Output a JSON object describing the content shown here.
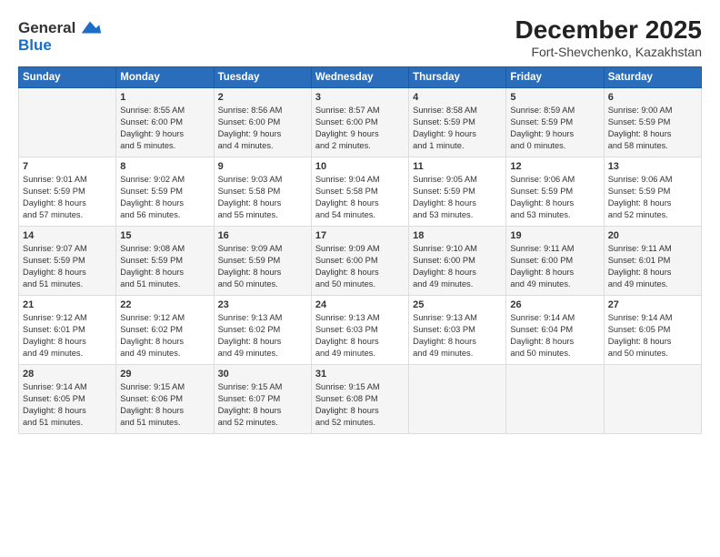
{
  "logo": {
    "general": "General",
    "blue": "Blue"
  },
  "title": "December 2025",
  "subtitle": "Fort-Shevchenko, Kazakhstan",
  "days_header": [
    "Sunday",
    "Monday",
    "Tuesday",
    "Wednesday",
    "Thursday",
    "Friday",
    "Saturday"
  ],
  "weeks": [
    [
      {
        "day": "",
        "text": ""
      },
      {
        "day": "1",
        "text": "Sunrise: 8:55 AM\nSunset: 6:00 PM\nDaylight: 9 hours\nand 5 minutes."
      },
      {
        "day": "2",
        "text": "Sunrise: 8:56 AM\nSunset: 6:00 PM\nDaylight: 9 hours\nand 4 minutes."
      },
      {
        "day": "3",
        "text": "Sunrise: 8:57 AM\nSunset: 6:00 PM\nDaylight: 9 hours\nand 2 minutes."
      },
      {
        "day": "4",
        "text": "Sunrise: 8:58 AM\nSunset: 5:59 PM\nDaylight: 9 hours\nand 1 minute."
      },
      {
        "day": "5",
        "text": "Sunrise: 8:59 AM\nSunset: 5:59 PM\nDaylight: 9 hours\nand 0 minutes."
      },
      {
        "day": "6",
        "text": "Sunrise: 9:00 AM\nSunset: 5:59 PM\nDaylight: 8 hours\nand 58 minutes."
      }
    ],
    [
      {
        "day": "7",
        "text": "Sunrise: 9:01 AM\nSunset: 5:59 PM\nDaylight: 8 hours\nand 57 minutes."
      },
      {
        "day": "8",
        "text": "Sunrise: 9:02 AM\nSunset: 5:59 PM\nDaylight: 8 hours\nand 56 minutes."
      },
      {
        "day": "9",
        "text": "Sunrise: 9:03 AM\nSunset: 5:58 PM\nDaylight: 8 hours\nand 55 minutes."
      },
      {
        "day": "10",
        "text": "Sunrise: 9:04 AM\nSunset: 5:58 PM\nDaylight: 8 hours\nand 54 minutes."
      },
      {
        "day": "11",
        "text": "Sunrise: 9:05 AM\nSunset: 5:59 PM\nDaylight: 8 hours\nand 53 minutes."
      },
      {
        "day": "12",
        "text": "Sunrise: 9:06 AM\nSunset: 5:59 PM\nDaylight: 8 hours\nand 53 minutes."
      },
      {
        "day": "13",
        "text": "Sunrise: 9:06 AM\nSunset: 5:59 PM\nDaylight: 8 hours\nand 52 minutes."
      }
    ],
    [
      {
        "day": "14",
        "text": "Sunrise: 9:07 AM\nSunset: 5:59 PM\nDaylight: 8 hours\nand 51 minutes."
      },
      {
        "day": "15",
        "text": "Sunrise: 9:08 AM\nSunset: 5:59 PM\nDaylight: 8 hours\nand 51 minutes."
      },
      {
        "day": "16",
        "text": "Sunrise: 9:09 AM\nSunset: 5:59 PM\nDaylight: 8 hours\nand 50 minutes."
      },
      {
        "day": "17",
        "text": "Sunrise: 9:09 AM\nSunset: 6:00 PM\nDaylight: 8 hours\nand 50 minutes."
      },
      {
        "day": "18",
        "text": "Sunrise: 9:10 AM\nSunset: 6:00 PM\nDaylight: 8 hours\nand 49 minutes."
      },
      {
        "day": "19",
        "text": "Sunrise: 9:11 AM\nSunset: 6:00 PM\nDaylight: 8 hours\nand 49 minutes."
      },
      {
        "day": "20",
        "text": "Sunrise: 9:11 AM\nSunset: 6:01 PM\nDaylight: 8 hours\nand 49 minutes."
      }
    ],
    [
      {
        "day": "21",
        "text": "Sunrise: 9:12 AM\nSunset: 6:01 PM\nDaylight: 8 hours\nand 49 minutes."
      },
      {
        "day": "22",
        "text": "Sunrise: 9:12 AM\nSunset: 6:02 PM\nDaylight: 8 hours\nand 49 minutes."
      },
      {
        "day": "23",
        "text": "Sunrise: 9:13 AM\nSunset: 6:02 PM\nDaylight: 8 hours\nand 49 minutes."
      },
      {
        "day": "24",
        "text": "Sunrise: 9:13 AM\nSunset: 6:03 PM\nDaylight: 8 hours\nand 49 minutes."
      },
      {
        "day": "25",
        "text": "Sunrise: 9:13 AM\nSunset: 6:03 PM\nDaylight: 8 hours\nand 49 minutes."
      },
      {
        "day": "26",
        "text": "Sunrise: 9:14 AM\nSunset: 6:04 PM\nDaylight: 8 hours\nand 50 minutes."
      },
      {
        "day": "27",
        "text": "Sunrise: 9:14 AM\nSunset: 6:05 PM\nDaylight: 8 hours\nand 50 minutes."
      }
    ],
    [
      {
        "day": "28",
        "text": "Sunrise: 9:14 AM\nSunset: 6:05 PM\nDaylight: 8 hours\nand 51 minutes."
      },
      {
        "day": "29",
        "text": "Sunrise: 9:15 AM\nSunset: 6:06 PM\nDaylight: 8 hours\nand 51 minutes."
      },
      {
        "day": "30",
        "text": "Sunrise: 9:15 AM\nSunset: 6:07 PM\nDaylight: 8 hours\nand 52 minutes."
      },
      {
        "day": "31",
        "text": "Sunrise: 9:15 AM\nSunset: 6:08 PM\nDaylight: 8 hours\nand 52 minutes."
      },
      {
        "day": "",
        "text": ""
      },
      {
        "day": "",
        "text": ""
      },
      {
        "day": "",
        "text": ""
      }
    ]
  ]
}
